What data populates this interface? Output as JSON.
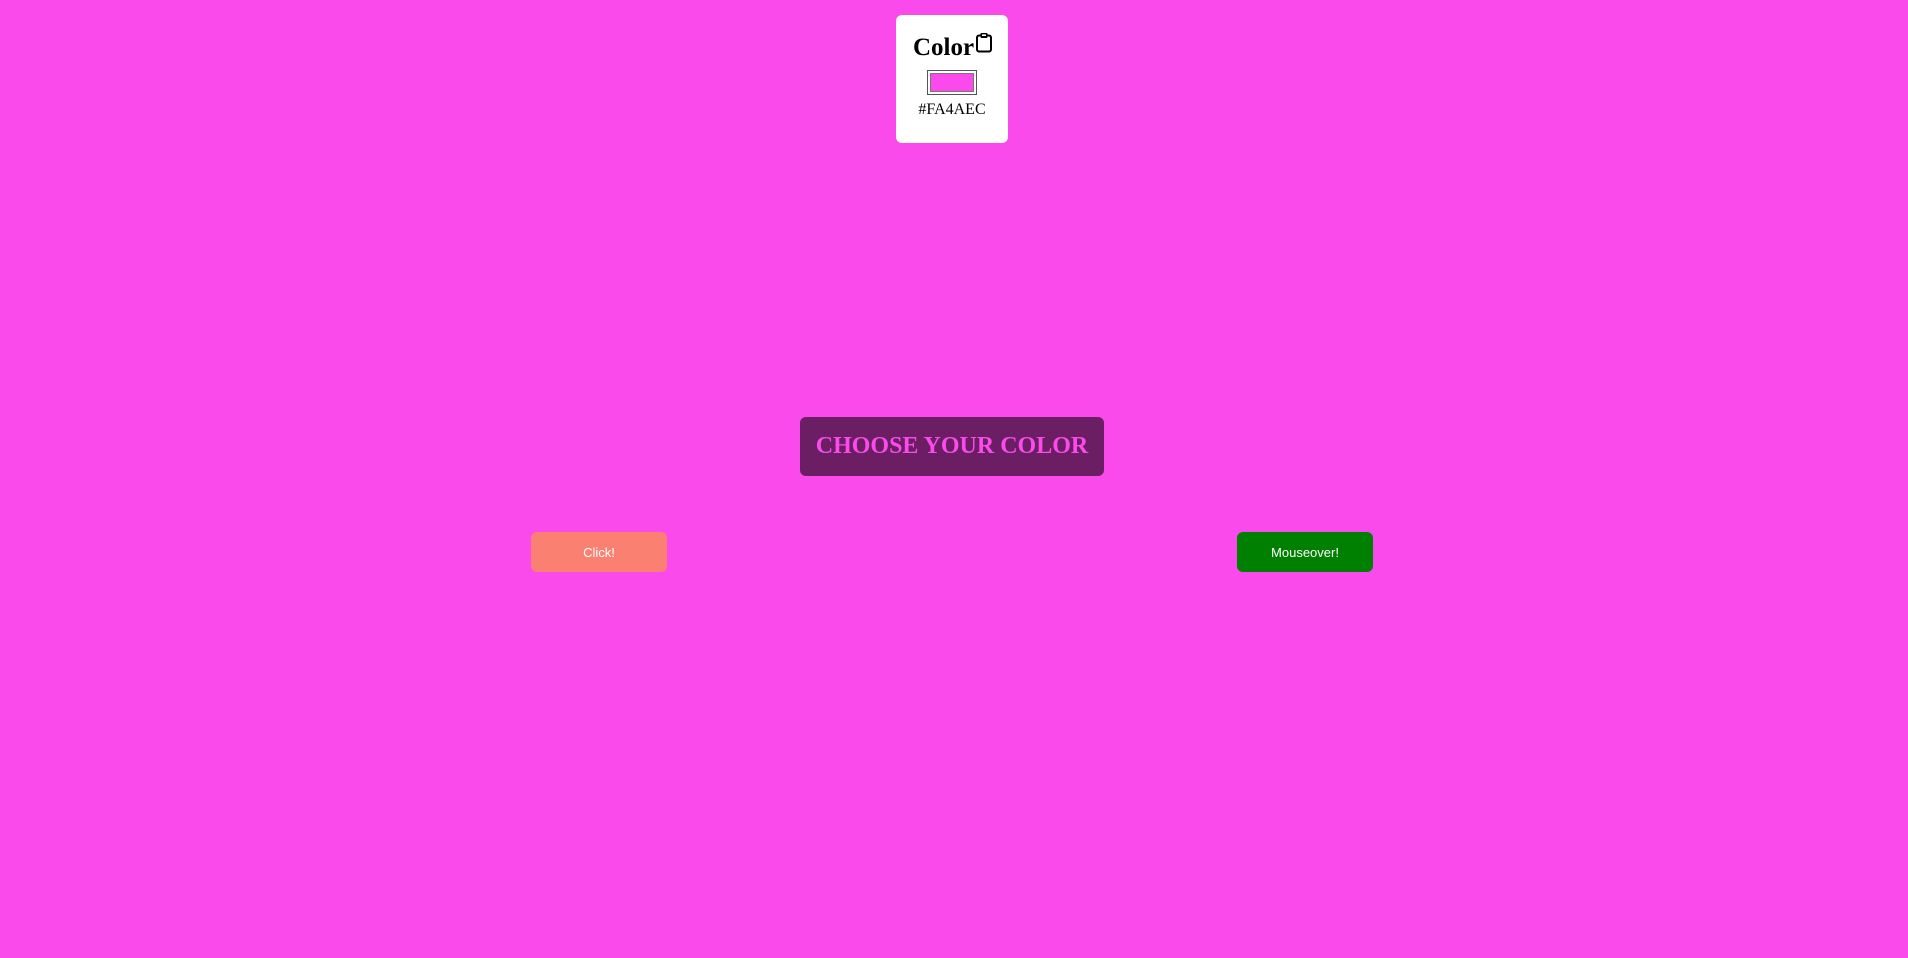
{
  "colors": {
    "background": "#FA4AEC",
    "banner_bg": "#6B1E63",
    "click_button_bg": "#FA8072",
    "mouseover_button_bg": "#008000"
  },
  "color_card": {
    "title": "Color",
    "copy_icon": "clipboard-icon",
    "hex_value": "#FA4AEC"
  },
  "banner": {
    "text": "CHOOSE YOUR COLOR"
  },
  "buttons": {
    "click_label": "Click!",
    "mouseover_label": "Mouseover!"
  }
}
